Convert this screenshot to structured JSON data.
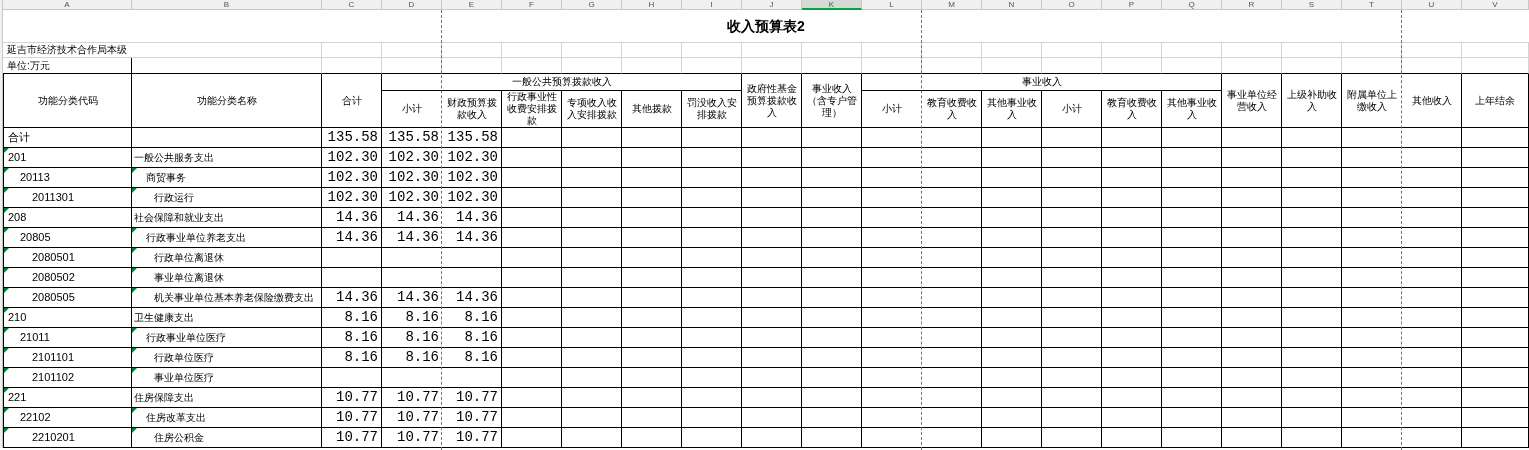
{
  "column_letters": [
    {
      "label": "A",
      "selected": false
    },
    {
      "label": "B",
      "selected": false
    },
    {
      "label": "C",
      "selected": false
    },
    {
      "label": "D",
      "selected": false
    },
    {
      "label": "E",
      "selected": false
    },
    {
      "label": "F",
      "selected": false
    },
    {
      "label": "G",
      "selected": false
    },
    {
      "label": "H",
      "selected": false
    },
    {
      "label": "I",
      "selected": false
    },
    {
      "label": "J",
      "selected": false
    },
    {
      "label": "K",
      "selected": true
    },
    {
      "label": "L",
      "selected": false
    },
    {
      "label": "M",
      "selected": false
    },
    {
      "label": "N",
      "selected": false
    },
    {
      "label": "O",
      "selected": false
    },
    {
      "label": "P",
      "selected": false
    },
    {
      "label": "Q",
      "selected": false
    },
    {
      "label": "R",
      "selected": false
    },
    {
      "label": "S",
      "selected": false
    },
    {
      "label": "T",
      "selected": false
    },
    {
      "label": "U",
      "selected": false
    },
    {
      "label": "V",
      "selected": false
    }
  ],
  "title": "收入预算表2",
  "organization": "延吉市经济技术合作局本级",
  "unit": "单位:万元",
  "header": {
    "code": "功能分类代码",
    "name": "功能分类名称",
    "total": "合计",
    "groups": [
      {
        "label": "一般公共预算拨款收入",
        "columns": [
          "小计",
          "财政预算拨款收入",
          "行政事业性收费安排拨款",
          "专项收入收入安排拨款",
          "其他拨款",
          "罚没收入安排拨款"
        ]
      },
      {
        "label": "政府性基金预算拨款收入"
      },
      {
        "label": "事业收入（含专户管理）"
      },
      {
        "label": "事业收入",
        "columns": [
          "小计",
          "教育收费收入",
          "其他事业收入",
          "小计",
          "教育收费收入",
          "其他事业收入"
        ]
      },
      {
        "label": "事业单位经营收入"
      },
      {
        "label": "上级补助收入"
      },
      {
        "label": "附属单位上缴收入"
      },
      {
        "label": "其他收入"
      },
      {
        "label": "上年结余"
      }
    ]
  },
  "total_row": {
    "label": "合计",
    "values": [
      "135.58",
      "135.58",
      "135.58"
    ]
  },
  "rows": [
    {
      "code": "201",
      "name": "一般公共服务支出",
      "values": [
        "102.30",
        "102.30",
        "102.30"
      ],
      "code_flag": true,
      "name_flag": false,
      "children": [
        {
          "code": "20113",
          "name": "商贸事务",
          "values": [
            "102.30",
            "102.30",
            "102.30"
          ],
          "code_flag": true,
          "name_flag": true,
          "children": [
            {
              "code": "2011301",
              "name": "行政运行",
              "values": [
                "102.30",
                "102.30",
                "102.30"
              ],
              "code_flag": true,
              "name_flag": true
            }
          ]
        }
      ]
    },
    {
      "code": "208",
      "name": "社会保障和就业支出",
      "values": [
        "14.36",
        "14.36",
        "14.36"
      ],
      "code_flag": true,
      "name_flag": false,
      "children": [
        {
          "code": "20805",
          "name": "行政事业单位养老支出",
          "values": [
            "14.36",
            "14.36",
            "14.36"
          ],
          "code_flag": true,
          "name_flag": true,
          "children": [
            {
              "code": "2080501",
              "name": "行政单位离退休",
              "code_flag": true,
              "name_flag": true
            },
            {
              "code": "2080502",
              "name": "事业单位离退休",
              "code_flag": true,
              "name_flag": true
            },
            {
              "code": "2080505",
              "name": "机关事业单位基本养老保险缴费支出",
              "values": [
                "14.36",
                "14.36",
                "14.36"
              ],
              "code_flag": true,
              "name_flag": true
            }
          ]
        }
      ]
    },
    {
      "code": "210",
      "name": "卫生健康支出",
      "values": [
        "8.16",
        "8.16",
        "8.16"
      ],
      "code_flag": true,
      "name_flag": false,
      "children": [
        {
          "code": "21011",
          "name": "行政事业单位医疗",
          "values": [
            "8.16",
            "8.16",
            "8.16"
          ],
          "code_flag": true,
          "name_flag": true,
          "children": [
            {
              "code": "2101101",
              "name": "行政单位医疗",
              "values": [
                "8.16",
                "8.16",
                "8.16"
              ],
              "code_flag": true,
              "name_flag": true
            },
            {
              "code": "2101102",
              "name": "事业单位医疗",
              "code_flag": true,
              "name_flag": true
            }
          ]
        }
      ]
    },
    {
      "code": "221",
      "name": "住房保障支出",
      "values": [
        "10.77",
        "10.77",
        "10.77"
      ],
      "code_flag": true,
      "name_flag": false,
      "children": [
        {
          "code": "22102",
          "name": "住房改革支出",
          "values": [
            "10.77",
            "10.77",
            "10.77"
          ],
          "code_flag": true,
          "name_flag": true,
          "children": [
            {
              "code": "2210201",
              "name": "住房公积金",
              "values": [
                "10.77",
                "10.77",
                "10.77"
              ],
              "code_flag": true,
              "name_flag": true
            }
          ]
        }
      ]
    }
  ]
}
